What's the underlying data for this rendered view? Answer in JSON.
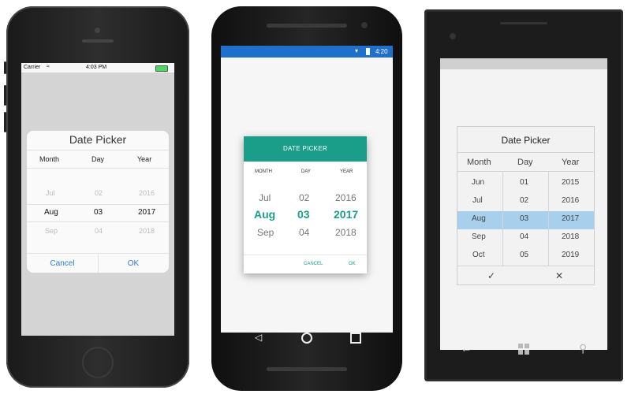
{
  "ios": {
    "status": {
      "carrier": "Carrier",
      "time": "4:03 PM"
    },
    "dialog": {
      "title": "Date Picker",
      "headers": {
        "month": "Month",
        "day": "Day",
        "year": "Year"
      },
      "month_above": "Jul",
      "day_above": "02",
      "year_above": "2016",
      "month_selected": "Aug",
      "day_selected": "03",
      "year_selected": "2017",
      "month_below": "Sep",
      "day_below": "04",
      "year_below": "2018",
      "cancel_label": "Cancel",
      "ok_label": "OK"
    }
  },
  "android": {
    "status": {
      "time": "4:20"
    },
    "dialog": {
      "title": "DATE PICKER",
      "headers": {
        "month": "MONTH",
        "day": "DAY",
        "year": "YEAR"
      },
      "month_above": "Jul",
      "day_above": "02",
      "year_above": "2016",
      "month_selected": "Aug",
      "day_selected": "03",
      "year_selected": "2017",
      "month_below": "Sep",
      "day_below": "04",
      "year_below": "2018",
      "cancel_label": "CANCEL",
      "ok_label": "OK"
    },
    "nav_icons": [
      "back-icon",
      "home-icon",
      "recents-icon"
    ]
  },
  "windows": {
    "dialog": {
      "title": "Date Picker",
      "headers": {
        "month": "Month",
        "day": "Day",
        "year": "Year"
      },
      "months": [
        "Jun",
        "Jul",
        "Aug",
        "Sep",
        "Oct"
      ],
      "days": [
        "01",
        "02",
        "03",
        "04",
        "05"
      ],
      "years": [
        "2015",
        "2016",
        "2017",
        "2018",
        "2019"
      ],
      "selected_index": 2,
      "ok_icon": "checkmark-icon",
      "cancel_icon": "close-icon"
    },
    "nav_icons": [
      "back-icon",
      "windows-start-icon",
      "search-icon"
    ]
  },
  "colors": {
    "android_accent": "#1a9e8a",
    "android_statusbar": "#1f6fcc",
    "ios_button": "#2f7bdc",
    "windows_selection": "#a8d0ec"
  }
}
